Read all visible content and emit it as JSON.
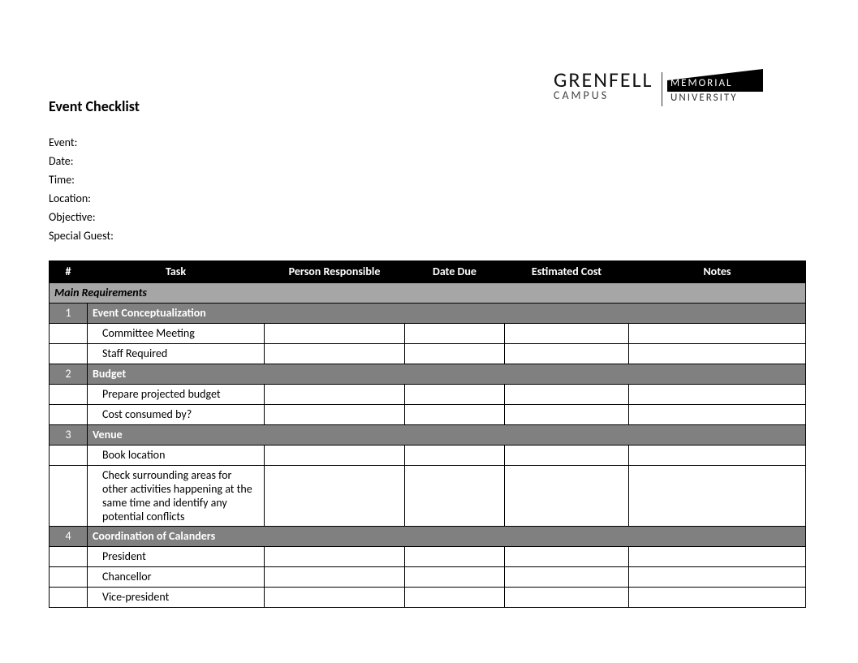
{
  "title": "Event Checklist",
  "logo": {
    "line1": "GRENFELL",
    "line2": "CAMPUS",
    "right_top": "MEMORIAL",
    "right_bottom": "UNIVERSITY"
  },
  "meta": {
    "event_label": "Event:",
    "date_label": "Date:",
    "time_label": "Time:",
    "location_label": "Location:",
    "objective_label": "Objective:",
    "guest_label": "Special Guest:"
  },
  "columns": {
    "num": "#",
    "task": "Task",
    "person": "Person Responsible",
    "due": "Date Due",
    "cost": "Estimated Cost",
    "notes": "Notes"
  },
  "section_title": "Main Requirements",
  "groups": [
    {
      "num": "1",
      "title": "Event Conceptualization",
      "items": [
        {
          "task": "Committee Meeting"
        },
        {
          "task": "Staff Required"
        }
      ]
    },
    {
      "num": "2",
      "title": "Budget",
      "items": [
        {
          "task": "Prepare projected budget"
        },
        {
          "task": "Cost consumed by?"
        }
      ]
    },
    {
      "num": "3",
      "title": "Venue",
      "items": [
        {
          "task": "Book location"
        },
        {
          "task": "Check surrounding areas for other activities happening at the same time and identify any potential conflicts"
        }
      ]
    },
    {
      "num": "4",
      "title": "Coordination of Calanders",
      "items": [
        {
          "task": "President"
        },
        {
          "task": "Chancellor"
        },
        {
          "task": "Vice-president"
        }
      ]
    }
  ]
}
